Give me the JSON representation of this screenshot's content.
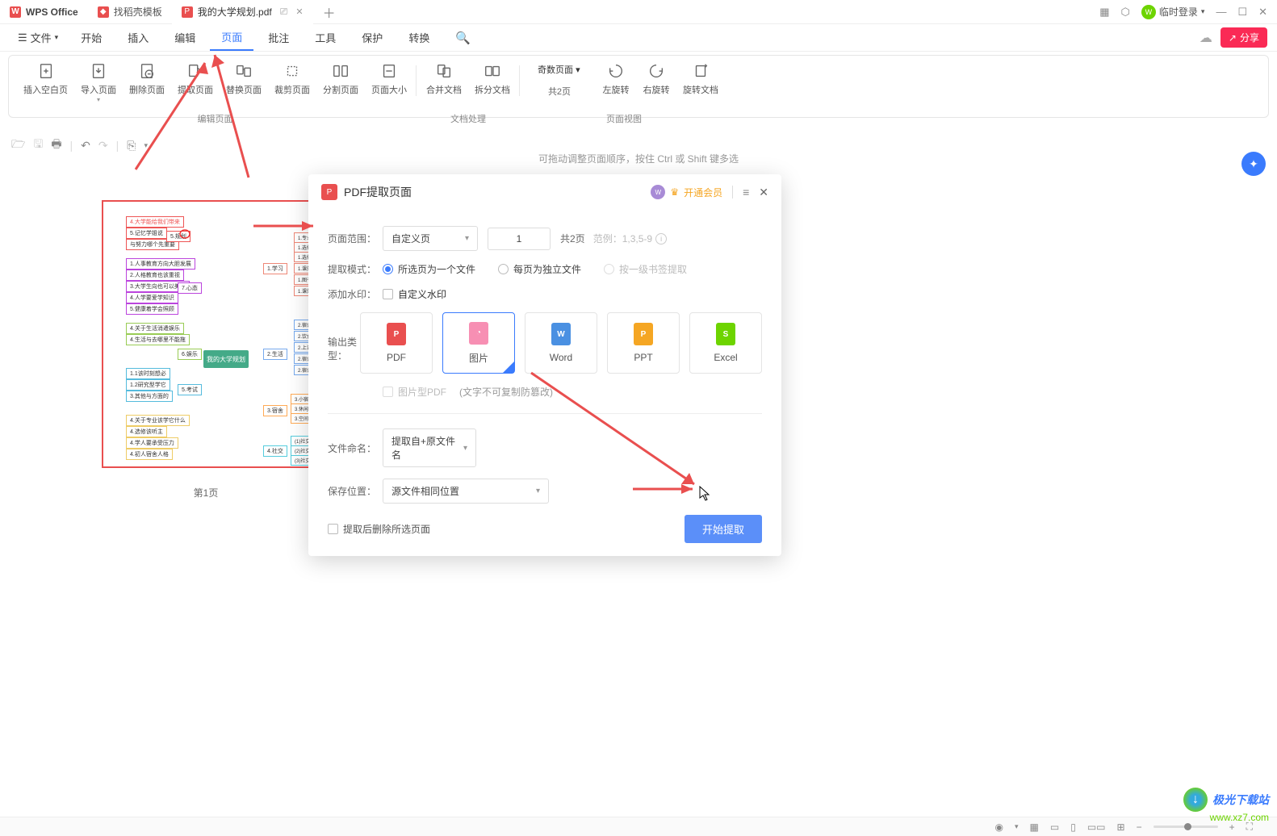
{
  "titlebar": {
    "app_name": "WPS Office",
    "tabs": [
      {
        "label": "找稻壳模板",
        "icon": "red"
      },
      {
        "label": "我的大学规划.pdf",
        "icon": "pdf",
        "active": true
      }
    ],
    "login_label": "临时登录"
  },
  "menubar": {
    "file_label": "文件",
    "items": [
      "开始",
      "插入",
      "编辑",
      "页面",
      "批注",
      "工具",
      "保护",
      "转换"
    ],
    "active_index": 3,
    "share_label": "分享"
  },
  "ribbon": {
    "groups": [
      {
        "label": "编辑页面",
        "buttons": [
          {
            "label": "插入空白页",
            "icon": "insert-blank"
          },
          {
            "label": "导入页面",
            "icon": "import-page",
            "dropdown": true
          },
          {
            "label": "删除页面",
            "icon": "delete-page"
          },
          {
            "label": "提取页面",
            "icon": "extract-page"
          },
          {
            "label": "替换页面",
            "icon": "replace-page"
          },
          {
            "label": "裁剪页面",
            "icon": "crop-page"
          },
          {
            "label": "分割页面",
            "icon": "split-page"
          },
          {
            "label": "页面大小",
            "icon": "page-size"
          }
        ]
      },
      {
        "label": "文档处理",
        "buttons": [
          {
            "label": "合并文档",
            "icon": "merge-doc"
          },
          {
            "label": "拆分文档",
            "icon": "split-doc"
          }
        ]
      },
      {
        "label": "页面视图",
        "buttons": [
          {
            "label": "奇数页面",
            "icon": "odd-pages",
            "dropdown": true,
            "wide": true
          },
          {
            "label": "共2页",
            "icon": "",
            "text_only": true
          },
          {
            "label": "左旋转",
            "icon": "rotate-left"
          },
          {
            "label": "右旋转",
            "icon": "rotate-right"
          },
          {
            "label": "旋转文档",
            "icon": "rotate-doc"
          }
        ]
      }
    ]
  },
  "canvas": {
    "hint": "可拖动调整页面顺序，按住 Ctrl 或 Shift 键多选",
    "thumb_label": "第1页",
    "mindmap_center": "我的大学规划",
    "mindmap_branches": [
      "1.学习",
      "7.心态",
      "6.娱乐",
      "5.考试",
      "2.生活",
      "3.宿舍",
      "4.社交"
    ]
  },
  "dialog": {
    "title": "PDF提取页面",
    "vip_label": "开通会员",
    "page_range_label": "页面范围：",
    "page_range_value": "自定义页",
    "page_input": "1",
    "page_total": "共2页",
    "page_example": "范例：1,3,5-9",
    "extract_mode_label": "提取模式：",
    "mode_options": [
      "所选页为一个文件",
      "每页为独立文件",
      "按一级书签提取"
    ],
    "mode_selected": 0,
    "watermark_label": "添加水印：",
    "watermark_option": "自定义水印",
    "output_label": "输出类型：",
    "output_options": [
      {
        "label": "PDF",
        "type": "pdf"
      },
      {
        "label": "图片",
        "type": "img"
      },
      {
        "label": "Word",
        "type": "word"
      },
      {
        "label": "PPT",
        "type": "ppt"
      },
      {
        "label": "Excel",
        "type": "xls"
      }
    ],
    "output_selected": 1,
    "sub_check": "图片型PDF",
    "sub_note": "(文字不可复制防篡改)",
    "filename_label": "文件命名：",
    "filename_value": "提取自+原文件名",
    "savepath_label": "保存位置：",
    "savepath_value": "源文件相同位置",
    "delete_check": "提取后删除所选页面",
    "start_label": "开始提取"
  },
  "watermark": {
    "name": "极光下载站",
    "url": "www.xz7.com"
  }
}
